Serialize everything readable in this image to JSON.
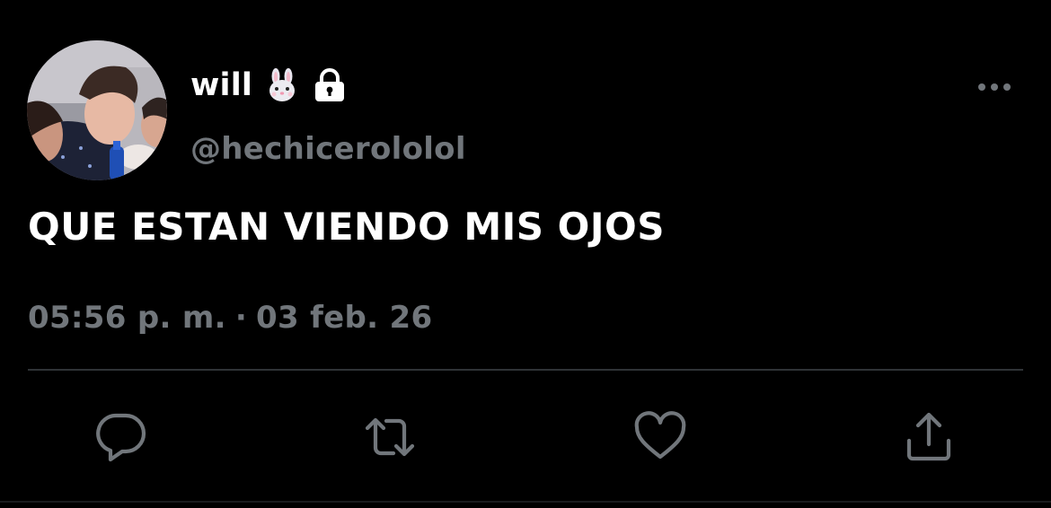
{
  "colors": {
    "background": "#000000",
    "primary_text": "#ffffff",
    "secondary_text": "#71767b",
    "divider": "#2f3336"
  },
  "tweet": {
    "author": {
      "display_name": "will",
      "name_emoji_icon": "rabbit-face-icon",
      "protected_icon": "lock-icon",
      "handle": "@hechicerololol",
      "avatar": "profile-photo"
    },
    "text": "QUE ESTAN VIENDO MIS OJOS",
    "time": "05:56 p. m.",
    "separator": "·",
    "date": "03 feb. 26"
  },
  "actions": [
    {
      "name": "reply",
      "icon": "speech-bubble-icon"
    },
    {
      "name": "retweet",
      "icon": "retweet-arrows-icon"
    },
    {
      "name": "like",
      "icon": "heart-icon"
    },
    {
      "name": "share",
      "icon": "share-upload-icon"
    }
  ],
  "more_menu_icon": "more-dots-icon"
}
